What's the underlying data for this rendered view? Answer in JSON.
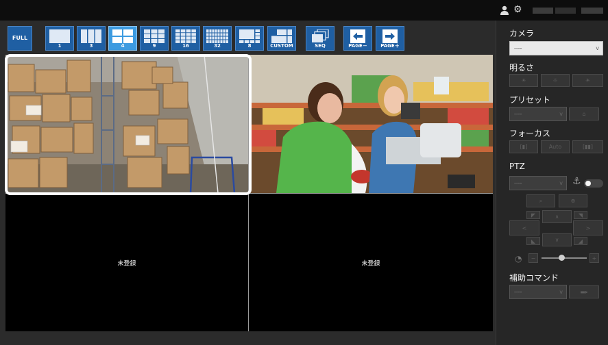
{
  "topbar": {
    "user_icon": "user-icon",
    "settings_icon": "gear-icon"
  },
  "toolbar": {
    "buttons": [
      {
        "id": "full",
        "label": "FULL"
      },
      {
        "id": "1",
        "label": "1"
      },
      {
        "id": "3",
        "label": "3"
      },
      {
        "id": "4",
        "label": "4",
        "active": true
      },
      {
        "id": "9",
        "label": "9"
      },
      {
        "id": "16",
        "label": "16"
      },
      {
        "id": "32",
        "label": "32"
      },
      {
        "id": "8",
        "label": "8"
      },
      {
        "id": "custom",
        "label": "CUSTOM"
      },
      {
        "id": "seq",
        "label": "SEQ"
      },
      {
        "id": "page-prev",
        "label": "PAGE－"
      },
      {
        "id": "page-next",
        "label": "PAGE＋"
      }
    ]
  },
  "grid": {
    "cells": [
      {
        "state": "camera",
        "scene": "warehouse",
        "selected": true
      },
      {
        "state": "camera",
        "scene": "supermarket"
      },
      {
        "state": "empty",
        "message": "未登録"
      },
      {
        "state": "empty",
        "message": "未登録"
      }
    ]
  },
  "panel": {
    "camera": {
      "title": "カメラ",
      "value": "----"
    },
    "brightness": {
      "title": "明るさ"
    },
    "preset": {
      "title": "プリセット",
      "value": "----"
    },
    "focus": {
      "title": "フォーカス",
      "auto_label": "Auto"
    },
    "ptz": {
      "title": "PTZ",
      "value": "----"
    },
    "aux": {
      "title": "補助コマンド",
      "value": "----"
    }
  },
  "colors": {
    "toolbar_button": "#1f5fa3",
    "toolbar_active": "#3d9be0",
    "selection": "#ffffff"
  }
}
